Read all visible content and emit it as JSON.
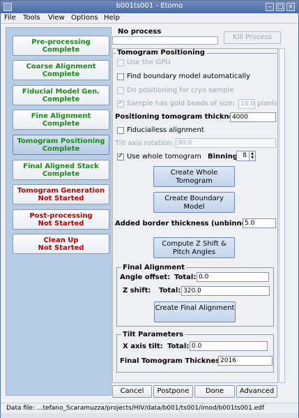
{
  "window": {
    "title": "b001ts001 - Etomo"
  },
  "menu": {
    "file": "File",
    "tools": "Tools",
    "view": "View",
    "options": "Options",
    "help": "Help"
  },
  "stages": [
    {
      "name": "Pre-processing",
      "status": "Complete"
    },
    {
      "name": "Coarse Alignment",
      "status": "Complete"
    },
    {
      "name": "Fiducial Model Gen.",
      "status": "Complete"
    },
    {
      "name": "Fine Alignment",
      "status": "Complete"
    },
    {
      "name": "Tomogram Positioning",
      "status": "Complete"
    },
    {
      "name": "Final Aligned Stack",
      "status": "Complete"
    },
    {
      "name": "Tomogram Generation",
      "status": "Not Started"
    },
    {
      "name": "Post-processing",
      "status": "Not Started"
    },
    {
      "name": "Clean Up",
      "status": "Not Started"
    }
  ],
  "process": {
    "label": "No process",
    "kill": "Kill Process"
  },
  "positioning": {
    "title": "Tomogram Positioning",
    "use_gpu": "Use the GPU",
    "find_boundary": "Find boundary model automatically",
    "cryo": "Do positioning for cryo sample",
    "gold_beads": "Sample has gold beads of size:",
    "gold_size": "10.0",
    "pixels": "pixels",
    "thickness_label": "Positioning tomogram thickness:",
    "thickness": "4000",
    "fiducialless": "Fiducialless alignment",
    "tilt_axis_label": "Tilt axis rotation:",
    "tilt_axis": "90.0",
    "whole_tomo": "Use whole tomogram",
    "binning_label": "Binning",
    "binning": "8",
    "create_whole": "Create Whole Tomogram",
    "create_boundary": "Create Boundary Model",
    "border_label": "Added border thickness (unbinned):",
    "border": "5.0",
    "compute_z": "Compute Z Shift & Pitch Angles"
  },
  "final_alignment": {
    "title": "Final Alignment",
    "angle_label": "Angle offset:",
    "total1": "Total:",
    "angle": "0.0",
    "zshift_label": "Z shift:",
    "total2": "Total:",
    "zshift": "320.0",
    "create": "Create Final Alignment"
  },
  "tilt_params": {
    "title": "Tilt Parameters",
    "x_label": "X axis tilt:",
    "total": "Total:",
    "x_tilt": "0.0",
    "thickness_label": "Final Tomogram Thickness:",
    "thickness": "2016"
  },
  "footer": {
    "cancel": "Cancel",
    "postpone": "Postpone",
    "done": "Done",
    "advanced": "Advanced"
  },
  "status": {
    "datafile": "Data file: ...tefano_Scaramuzza/projects/HIV/data/b001/ts001/imod/b001ts001.edf"
  }
}
